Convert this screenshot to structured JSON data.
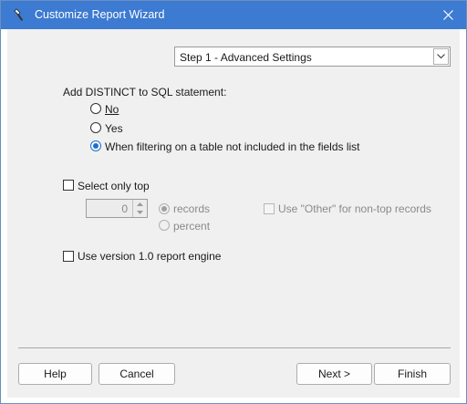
{
  "window": {
    "title": "Customize Report Wizard",
    "icons": {
      "app": "wand-icon",
      "close": "close-icon"
    }
  },
  "step_select": {
    "value": "Step 1 - Advanced Settings",
    "arrow_icon": "chevron-down-icon"
  },
  "distinct": {
    "heading": "Add DISTINCT to SQL statement:",
    "options": [
      {
        "label": "No",
        "checked": false
      },
      {
        "label": "Yes",
        "checked": false
      },
      {
        "label": "When filtering on a table not included in the fields list",
        "checked": true
      }
    ]
  },
  "select_top": {
    "label": "Select only top",
    "checked": false,
    "value": "0",
    "records_label": "records",
    "percent_label": "percent",
    "other_label": "Use \"Other\" for non-top records"
  },
  "version": {
    "label": "Use version 1.0 report engine",
    "checked": false
  },
  "buttons": {
    "help": "Help",
    "cancel": "Cancel",
    "next": "Next >",
    "finish": "Finish"
  },
  "colors": {
    "titlebar": "#3d7ad1",
    "accent": "#1a6fd0"
  }
}
